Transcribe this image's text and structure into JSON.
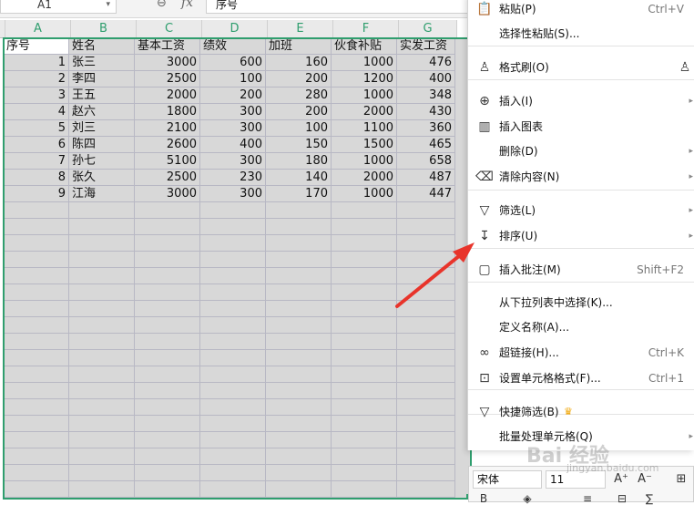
{
  "toolbar": {
    "name_box": "A1",
    "fx": "fx",
    "formula_value": "序号"
  },
  "columns": [
    "A",
    "B",
    "C",
    "D",
    "E",
    "F",
    "G"
  ],
  "table": {
    "headers": [
      "序号",
      "姓名",
      "基本工资",
      "绩效",
      "加班",
      "伙食补贴",
      "实发工资"
    ],
    "rows": [
      [
        "1",
        "张三",
        "3000",
        "600",
        "160",
        "1000",
        "476"
      ],
      [
        "2",
        "李四",
        "2500",
        "100",
        "200",
        "1200",
        "400"
      ],
      [
        "3",
        "王五",
        "2000",
        "200",
        "280",
        "1000",
        "348"
      ],
      [
        "4",
        "赵六",
        "1800",
        "300",
        "200",
        "2000",
        "430"
      ],
      [
        "5",
        "刘三",
        "2100",
        "300",
        "100",
        "1100",
        "360"
      ],
      [
        "6",
        "陈四",
        "2600",
        "400",
        "150",
        "1500",
        "465"
      ],
      [
        "7",
        "孙七",
        "5100",
        "300",
        "180",
        "1000",
        "658"
      ],
      [
        "8",
        "张久",
        "2500",
        "230",
        "140",
        "2000",
        "487"
      ],
      [
        "9",
        "江海",
        "3000",
        "300",
        "170",
        "1000",
        "447"
      ]
    ]
  },
  "context_menu": [
    {
      "label": "粘贴(P)",
      "shortcut": "Ctrl+V",
      "icon": "paste-icon"
    },
    {
      "label": "选择性粘贴(S)...",
      "icon": "paste-special-icon"
    },
    {
      "label": "格式刷(O)",
      "icon": "format-painter-icon"
    },
    {
      "label": "插入(I)",
      "icon": "insert-icon",
      "submenu": true
    },
    {
      "label": "插入图表",
      "icon": "chart-icon"
    },
    {
      "label": "删除(D)",
      "icon": "",
      "submenu": true
    },
    {
      "label": "清除内容(N)",
      "icon": "eraser-icon",
      "submenu": true
    },
    {
      "label": "筛选(L)",
      "icon": "filter-icon",
      "submenu": true
    },
    {
      "label": "排序(U)",
      "icon": "sort-icon",
      "submenu": true
    },
    {
      "label": "插入批注(M)",
      "shortcut": "Shift+F2",
      "icon": "comment-icon"
    },
    {
      "label": "从下拉列表中选择(K)...",
      "icon": ""
    },
    {
      "label": "定义名称(A)...",
      "icon": ""
    },
    {
      "label": "超链接(H)...",
      "shortcut": "Ctrl+K",
      "icon": "link-icon"
    },
    {
      "label": "设置单元格格式(F)...",
      "shortcut": "Ctrl+1",
      "icon": "cell-format-icon"
    },
    {
      "label": "快捷筛选(B)",
      "icon": "quick-filter-icon",
      "premium": true
    },
    {
      "label": "批量处理单元格(Q)",
      "icon": "",
      "submenu": true
    }
  ],
  "mini_toolbar": {
    "font": "宋体",
    "size": "11"
  },
  "watermark": {
    "brand": "Bai 经验",
    "url": "jingyan.baidu.com"
  },
  "colors": {
    "accent": "#2f9e6e",
    "arrow": "#e8342b",
    "selection_fill": "#d8d8d8"
  }
}
